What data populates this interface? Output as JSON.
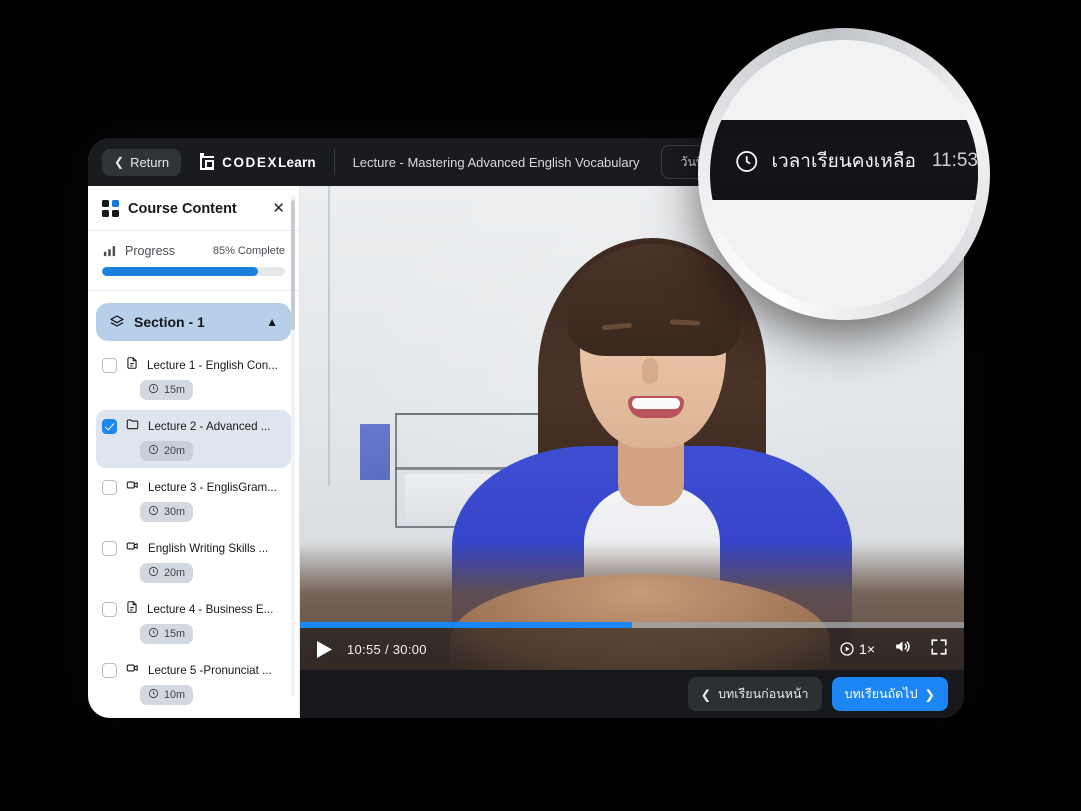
{
  "topbar": {
    "return_label": "Return",
    "logo_primary": "CODEX",
    "logo_secondary": "Learn",
    "lecture_title": "Lecture - Mastering Advanced English Vocabulary",
    "days_remaining_label": "วันที่เรียนคงเหลือ",
    "time_remaining_label": "เวลาเรียนคงเหลือ",
    "time_remaining_value": "11:53"
  },
  "sidebar": {
    "title": "Course Content",
    "close_label": "✕",
    "progress": {
      "label": "Progress",
      "percent_text": "85% Complete",
      "percent_value": 85
    },
    "section": {
      "name": "Section - 1",
      "expanded": true
    },
    "lessons": [
      {
        "name": "Lecture 1 - English Con...",
        "duration": "15m",
        "icon": "document-icon",
        "checked": false,
        "active": false
      },
      {
        "name": "Lecture 2 - Advanced ...",
        "duration": "20m",
        "icon": "folder-icon",
        "checked": true,
        "active": true
      },
      {
        "name": "Lecture 3 - EnglisGram...",
        "duration": "30m",
        "icon": "video-icon",
        "checked": false,
        "active": false
      },
      {
        "name": "English Writing Skills ...",
        "duration": "20m",
        "icon": "video-icon",
        "checked": false,
        "active": false
      },
      {
        "name": "Lecture 4 - Business E...",
        "duration": "15m",
        "icon": "document-icon",
        "checked": false,
        "active": false
      },
      {
        "name": "Lecture 5 -Pronunciat ...",
        "duration": "10m",
        "icon": "video-icon",
        "checked": false,
        "active": false
      }
    ]
  },
  "player": {
    "current_time": "10:55",
    "total_time": "30:00",
    "timecode": "10:55 / 30:00",
    "progress_percent": 50,
    "speed_label": "1×",
    "is_playing": false
  },
  "footer": {
    "prev_label": "บทเรียนก่อนหน้า",
    "next_label": "บทเรียนถัดไป"
  },
  "magnifier": {
    "label": "เวลาเรียนคงเหลือ",
    "value": "11:53"
  },
  "colors": {
    "accent": "#1d86f5",
    "progress_fill": "#1a82dd",
    "section_bg": "#b7cfe9",
    "window_bg": "#16181c",
    "topbar_bg": "#191b1f"
  }
}
